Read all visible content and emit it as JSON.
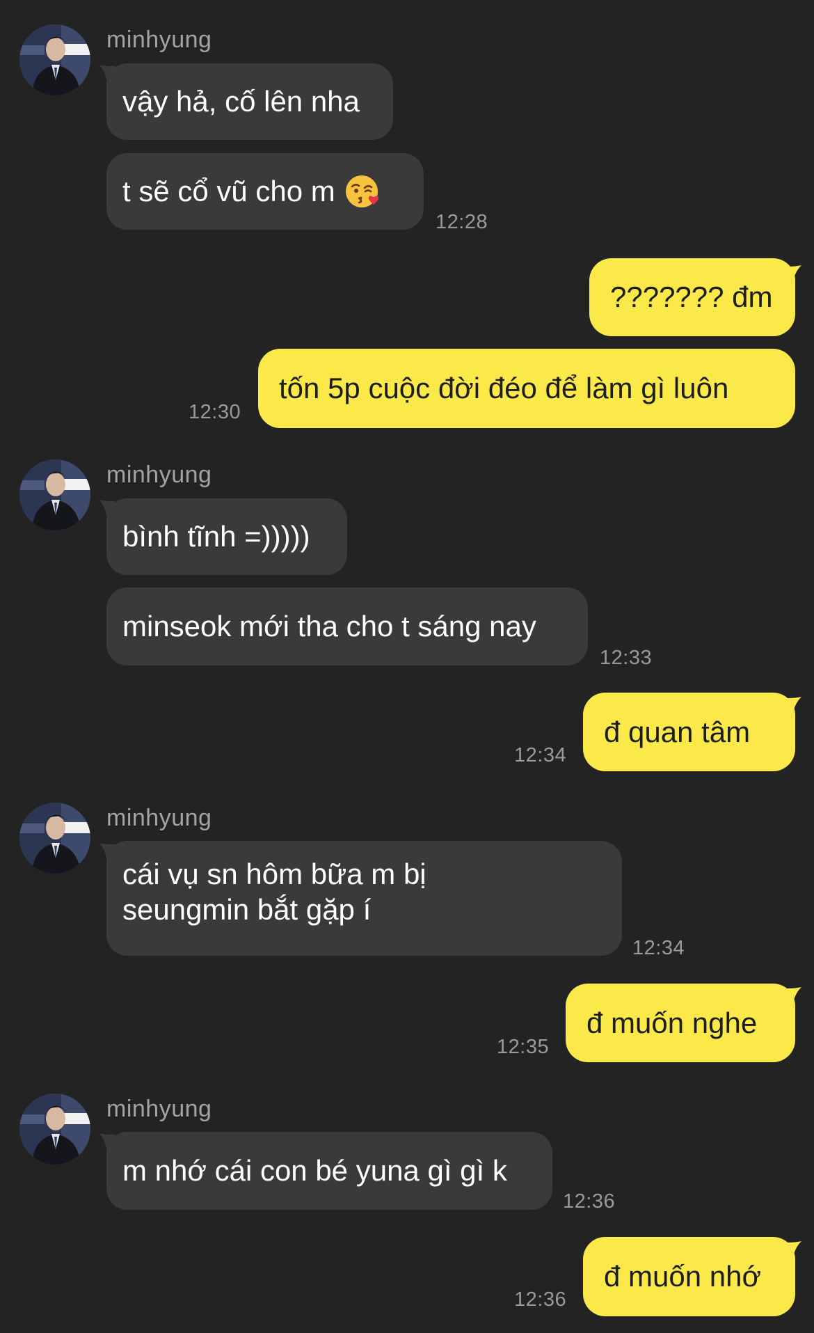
{
  "contact": {
    "name": "minhyung"
  },
  "groups": [
    {
      "sender": "minhyung",
      "messages": [
        {
          "text": "vậy hả, cố lên nha"
        },
        {
          "text": "t sẽ cổ vũ cho m",
          "emoji": "kissing-face-with-heart-emoji",
          "time": "12:28"
        }
      ]
    },
    {
      "messages": [
        {
          "text": "??????? đm"
        },
        {
          "text": "tốn 5p cuộc đời đéo để làm gì luôn",
          "time": "12:30"
        }
      ]
    },
    {
      "sender": "minhyung",
      "messages": [
        {
          "text": "bình tĩnh =)))))"
        },
        {
          "text": "minseok mới tha cho t sáng nay",
          "time": "12:33"
        }
      ]
    },
    {
      "messages": [
        {
          "text": "đ quan tâm",
          "time": "12:34"
        }
      ]
    },
    {
      "sender": "minhyung",
      "messages": [
        {
          "text": "cái vụ sn hôm bữa m bị seungmin bắt gặp í",
          "time": "12:34"
        }
      ]
    },
    {
      "messages": [
        {
          "text": "đ muốn nghe",
          "time": "12:35"
        }
      ]
    },
    {
      "sender": "minhyung",
      "messages": [
        {
          "text": "m nhớ cái con bé yuna gì gì k",
          "time": "12:36"
        }
      ]
    },
    {
      "messages": [
        {
          "text": "đ muốn nhớ",
          "time": "12:36"
        }
      ]
    }
  ],
  "colors": {
    "background": "#232323",
    "incoming_bubble": "#3a3a3b",
    "outgoing_bubble": "#fbe94a",
    "sender_name": "#a3a3a3",
    "timestamp": "#9a9a9a"
  }
}
